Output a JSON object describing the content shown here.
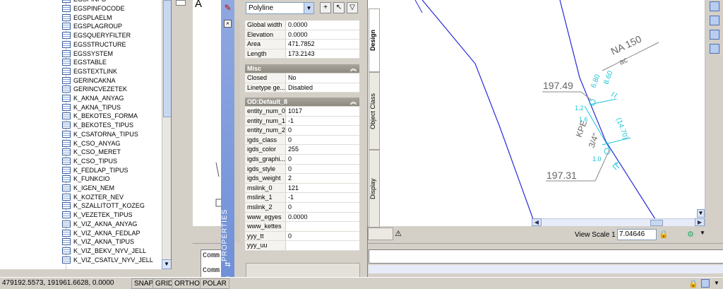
{
  "table_list": {
    "items": [
      "EGSPINFO",
      "EGSPINFOCODE",
      "EGSPLAELM",
      "EGSPLAGROUP",
      "EGSQUERYFILTER",
      "EGSSTRUCTURE",
      "EGSSYSTEM",
      "EGSTABLE",
      "EGSTEXTLINK",
      "GERINCAKNA",
      "GERINCVEZETEK",
      "K_AKNA_ANYAG",
      "K_AKNA_TIPUS",
      "K_BEKOTES_FORMA",
      "K_BEKOTES_TIPUS",
      "K_CSATORNA_TIPUS",
      "K_CSO_ANYAG",
      "K_CSO_MERET",
      "K_CSO_TIPUS",
      "K_FEDLAP_TIPUS",
      "K_FUNKCIO",
      "K_IGEN_NEM",
      "K_KOZTER_NEV",
      "K_SZALLITOTT_KOZEG",
      "K_VEZETEK_TIPUS",
      "K_VIZ_AKNA_ANYAG",
      "K_VIZ_AKNA_FEDLAP",
      "K_VIZ_AKNA_TIPUS",
      "K_VIZ_BEKV_NYV_JELL",
      "K_VIZ_CSATLV_NYV_JELL"
    ]
  },
  "canvas": {
    "corner_letter": "A"
  },
  "drawing": {
    "label_na150": "NA 150",
    "label_ac": "ac",
    "elev_top": "197.49",
    "elev_bottom": "197.31",
    "dim_680": "6.80",
    "dim_860": "8.60",
    "dim_1470": "(14.70)",
    "dim_12": "1.2",
    "dim_16": "1.6",
    "dim_10": "1.0",
    "kpe": "KPE",
    "size_34": "3/4\""
  },
  "properties": {
    "title": "PROPERTIES",
    "object_type": "Polyline",
    "geometry_rows": [
      {
        "name": "Global width",
        "value": "0.0000"
      },
      {
        "name": "Elevation",
        "value": "0.0000"
      },
      {
        "name": "Area",
        "value": "471.7852"
      },
      {
        "name": "Length",
        "value": "173.2143"
      }
    ],
    "misc_header": "Misc",
    "misc_rows": [
      {
        "name": "Closed",
        "value": "No"
      },
      {
        "name": "Linetype ge...",
        "value": "Disabled"
      }
    ],
    "od_header": "OD:Default_8",
    "od_rows": [
      {
        "name": "entity_num_0",
        "value": "1017"
      },
      {
        "name": "entity_num_1",
        "value": "-1"
      },
      {
        "name": "entity_num_2",
        "value": "0"
      },
      {
        "name": "igds_class",
        "value": "0"
      },
      {
        "name": "igds_color",
        "value": "255"
      },
      {
        "name": "igds_graphi...",
        "value": "0"
      },
      {
        "name": "igds_style",
        "value": "0"
      },
      {
        "name": "igds_weight",
        "value": "2"
      },
      {
        "name": "mslink_0",
        "value": "121"
      },
      {
        "name": "mslink_1",
        "value": "-1"
      },
      {
        "name": "mslink_2",
        "value": "0"
      },
      {
        "name": "www_egyes",
        "value": "0.0000"
      },
      {
        "name": "www_kettes",
        "value": ""
      },
      {
        "name": "yyy_tt",
        "value": "0"
      },
      {
        "name": "yyy_uu",
        "value": ""
      }
    ],
    "tabs": [
      "Design",
      "Object Class",
      "Display"
    ]
  },
  "view_toolbar": {
    "view_scale_label": "View Scale 1 :",
    "view_scale_value": "7.04646"
  },
  "command": {
    "line1": "Comm",
    "line2": "Comm"
  },
  "status_bar": {
    "coords": "479192.5573, 191961.6628, 0.0000",
    "buttons": [
      "SNAP",
      "GRID",
      "ORTHO",
      "POLAR"
    ]
  }
}
